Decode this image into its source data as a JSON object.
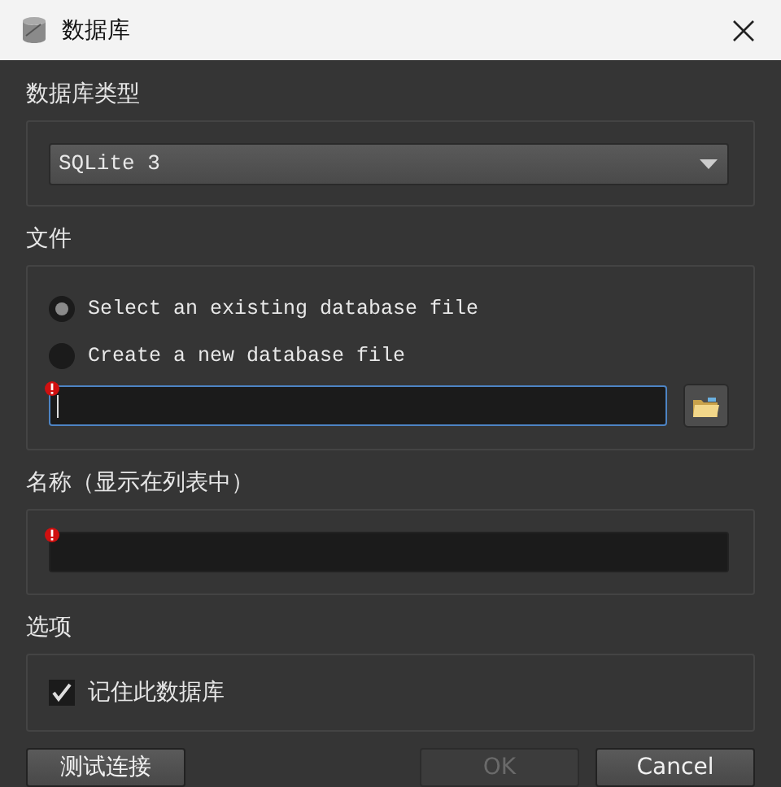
{
  "window": {
    "title": "数据库"
  },
  "database_type": {
    "label": "数据库类型",
    "value": "SQLite 3"
  },
  "file": {
    "label": "文件",
    "options": [
      {
        "label": "Select an existing database file",
        "selected": true
      },
      {
        "label": "Create a new database file",
        "selected": false
      }
    ],
    "path_field": {
      "error": true,
      "focused": true
    }
  },
  "name": {
    "label": "名称（显示在列表中）",
    "field": {
      "error": true,
      "focused": false
    }
  },
  "options": {
    "label": "选项",
    "items": [
      {
        "label": "记住此数据库",
        "checked": true
      }
    ]
  },
  "buttons": [
    {
      "label": "测试连接",
      "disabled": false
    },
    {
      "label": "OK",
      "disabled": true
    },
    {
      "label": "Cancel",
      "disabled": false
    }
  ]
}
